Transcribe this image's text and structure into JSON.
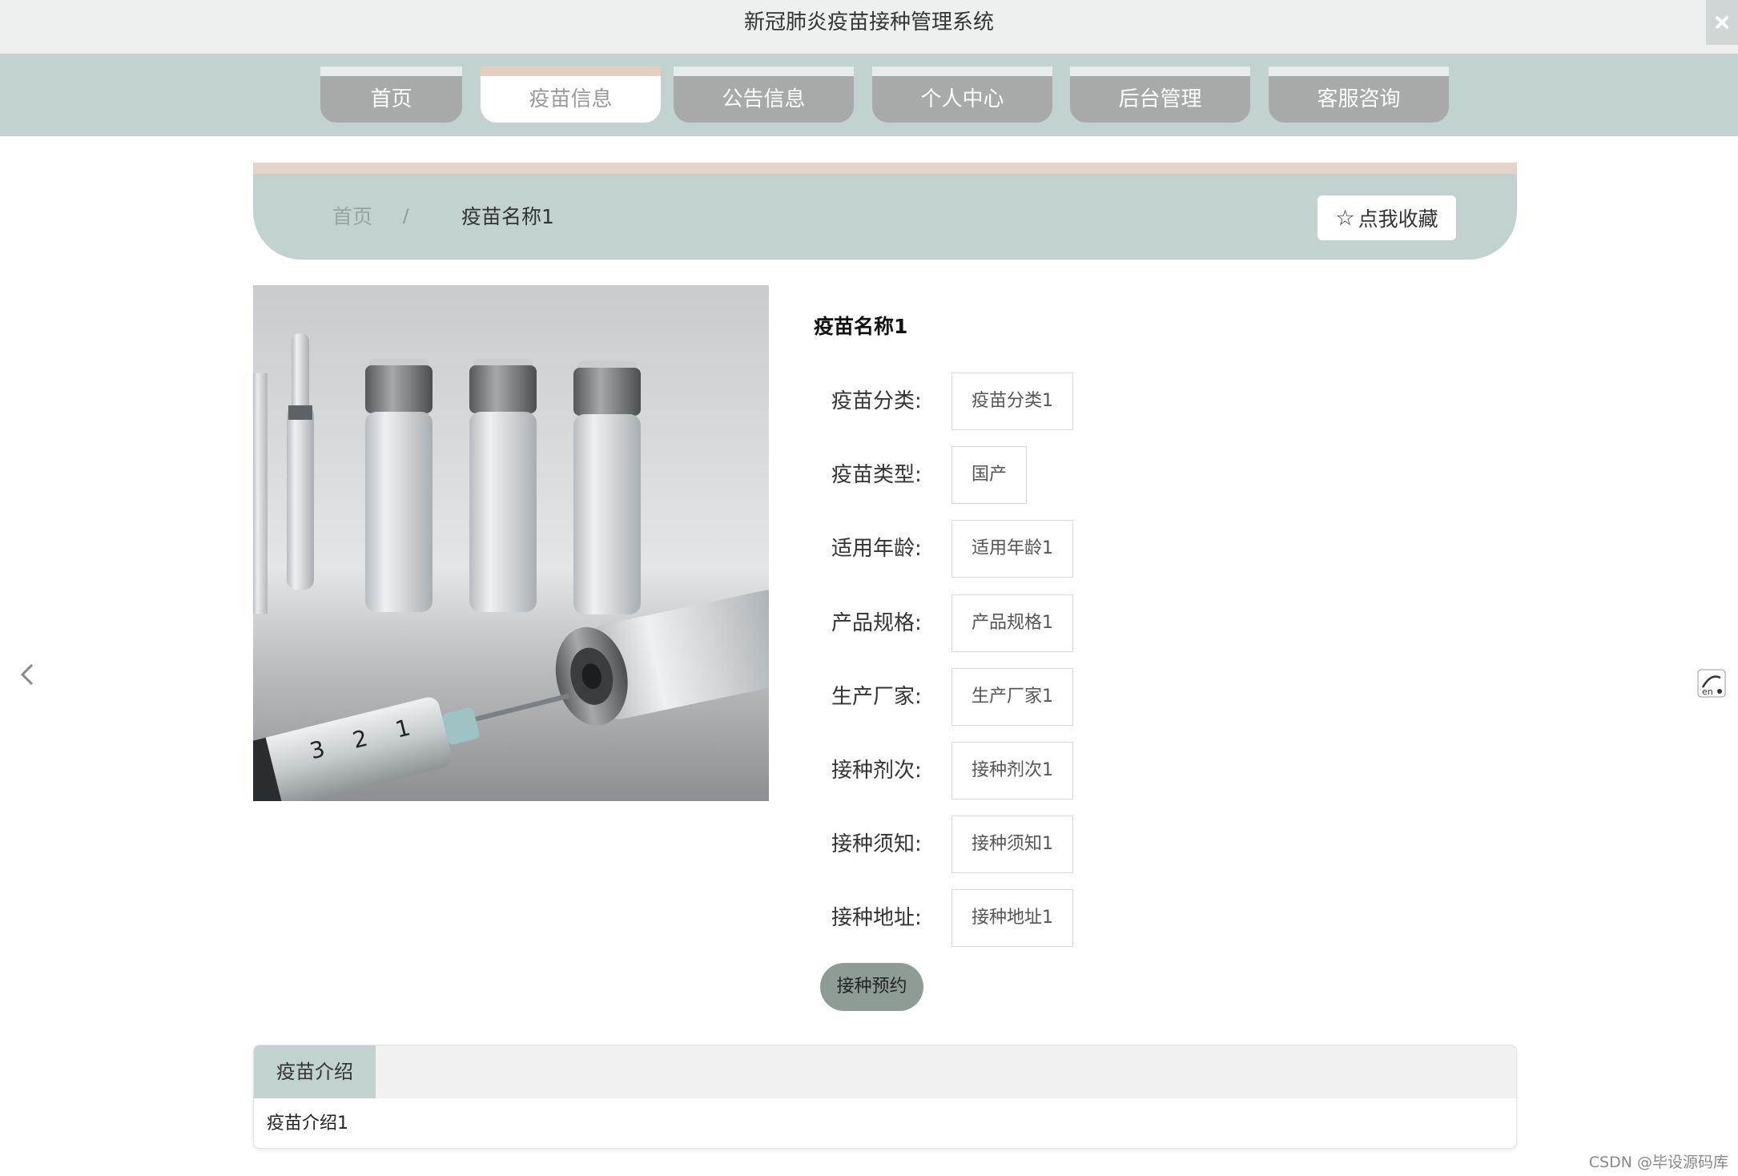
{
  "app": {
    "title": "新冠肺炎疫苗接种管理系统"
  },
  "nav": {
    "items": [
      {
        "label": "首页"
      },
      {
        "label": "疫苗信息"
      },
      {
        "label": "公告信息"
      },
      {
        "label": "个人中心"
      },
      {
        "label": "后台管理"
      },
      {
        "label": "客服咨询"
      }
    ],
    "active_index": 1
  },
  "breadcrumb": {
    "home": "首页",
    "separator": "/",
    "current": "疫苗名称1"
  },
  "favorite": {
    "label": "点我收藏",
    "icon": "star-outline-icon"
  },
  "detail": {
    "name": "疫苗名称1",
    "fields": [
      {
        "label": "疫苗分类:",
        "value": "疫苗分类1"
      },
      {
        "label": "疫苗类型:",
        "value": "国产"
      },
      {
        "label": "适用年龄:",
        "value": "适用年龄1"
      },
      {
        "label": "产品规格:",
        "value": "产品规格1"
      },
      {
        "label": "生产厂家:",
        "value": "生产厂家1"
      },
      {
        "label": "接种剂次:",
        "value": "接种剂次1"
      },
      {
        "label": "接种须知:",
        "value": "接种须知1"
      },
      {
        "label": "接种地址:",
        "value": "接种地址1"
      }
    ],
    "book_button": "接种预约"
  },
  "intro": {
    "tab_label": "疫苗介绍",
    "content": "疫苗介绍1"
  },
  "watermark": "CSDN @毕设源码库",
  "colors": {
    "nav_bg": "#c2d2d1",
    "nav_item": "#a8aaa9",
    "accent_peach": "#e2cfc1",
    "button_grey": "#8f9c96"
  }
}
